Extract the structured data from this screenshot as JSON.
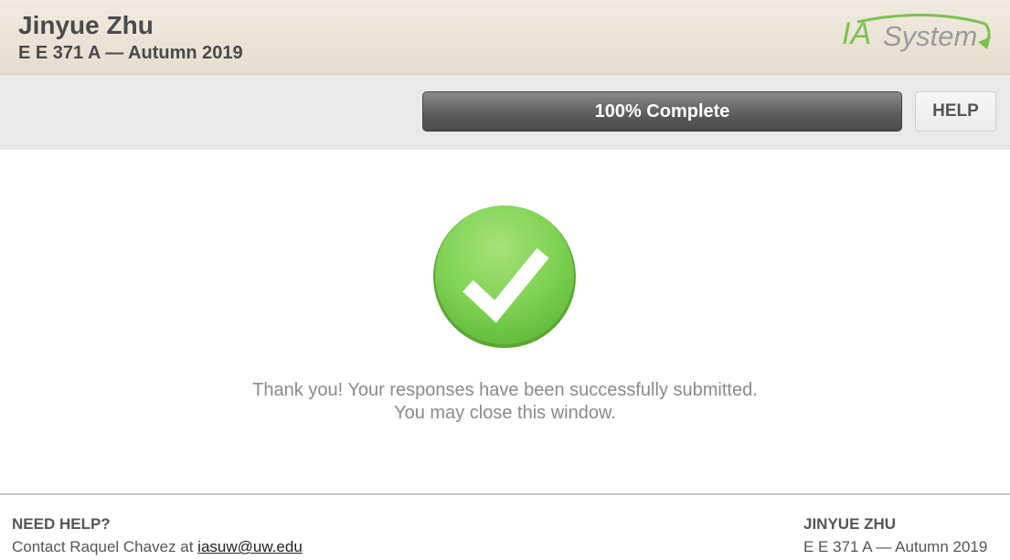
{
  "header": {
    "name": "Jinyue Zhu",
    "course": "E E 371 A — Autumn 2019",
    "logo_text": "IASystem"
  },
  "progress": {
    "value_percent": 100,
    "label": "100% Complete"
  },
  "help_button": {
    "label": "HELP"
  },
  "confirmation": {
    "line1": "Thank you! Your responses have been successfully submitted.",
    "line2": "You may close this window.",
    "icon": "checkmark-circle-icon",
    "color": "#6cc644"
  },
  "footer": {
    "help_title": "NEED HELP?",
    "help_contact_prefix": "Contact Raquel Chavez at ",
    "help_email": "iasuw@uw.edu",
    "user_name": "JINYUE ZHU",
    "user_course": "E E 371 A — Autumn 2019"
  }
}
